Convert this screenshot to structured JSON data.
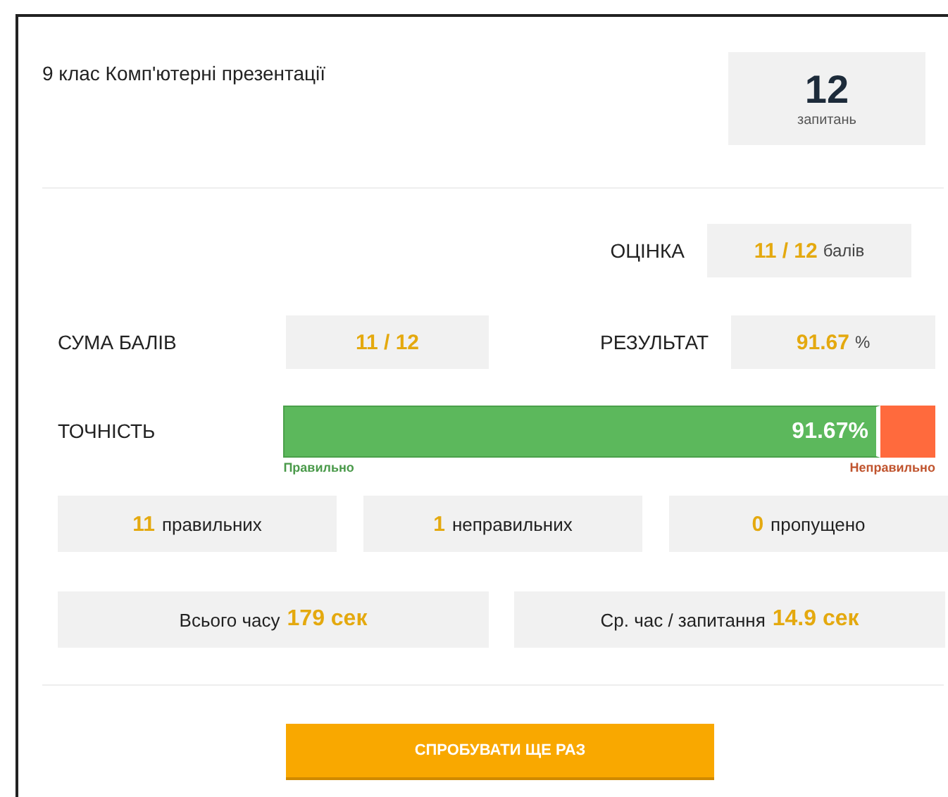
{
  "title": "9 клас Комп'ютерні презентації",
  "question_count": {
    "value": "12",
    "label": "запитань"
  },
  "grade": {
    "label": "ОЦІНКА",
    "value": "11 / 12",
    "unit": "балів"
  },
  "score_sum": {
    "label": "СУМА БАЛІВ",
    "value": "11 / 12"
  },
  "result": {
    "label": "РЕЗУЛЬТАТ",
    "value": "91.67",
    "unit": "%"
  },
  "accuracy": {
    "label": "ТОЧНІСТЬ",
    "level": 0.9167,
    "reading": "91.67%",
    "correct_label": "Правильно",
    "wrong_label": "Неправильно"
  },
  "stats": [
    {
      "value": "11",
      "label": "правильних"
    },
    {
      "value": "1",
      "label": "неправильних"
    },
    {
      "value": "0",
      "label": "пропущено"
    }
  ],
  "times": [
    {
      "label": "Всього часу",
      "value": "179 сек"
    },
    {
      "label": "Ср. час / запитання",
      "value": "14.9 сек"
    }
  ],
  "retry_button": "СПРОБУВАТИ ЩЕ РАЗ"
}
